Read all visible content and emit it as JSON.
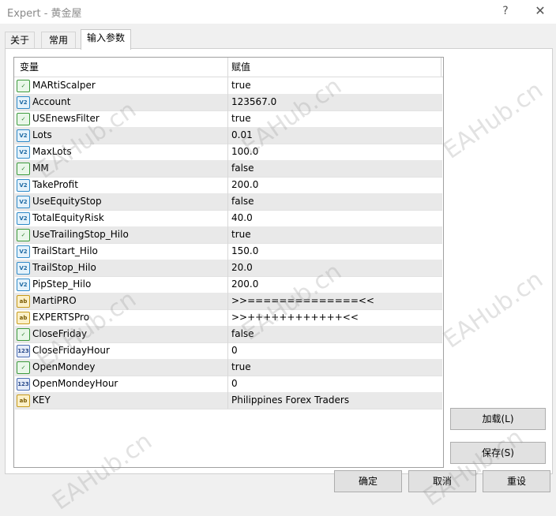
{
  "window": {
    "title": "Expert - 黄金屋",
    "help_label": "?",
    "close_label": "✕"
  },
  "tabs": [
    {
      "label": "关于",
      "active": false
    },
    {
      "label": "常用",
      "active": false
    },
    {
      "label": "输入参数",
      "active": true
    }
  ],
  "grid": {
    "headers": {
      "variable": "变量",
      "value": "赋值"
    },
    "rows": [
      {
        "type": "bool",
        "icon_label": "✓",
        "name": "MARtiScalper",
        "value": "true"
      },
      {
        "type": "double",
        "icon_label": "V2",
        "name": "Account",
        "value": "123567.0"
      },
      {
        "type": "bool",
        "icon_label": "✓",
        "name": "USEnewsFilter",
        "value": "true"
      },
      {
        "type": "double",
        "icon_label": "V2",
        "name": "Lots",
        "value": "0.01"
      },
      {
        "type": "double",
        "icon_label": "V2",
        "name": "MaxLots",
        "value": "100.0"
      },
      {
        "type": "bool",
        "icon_label": "✓",
        "name": "MM",
        "value": "false"
      },
      {
        "type": "double",
        "icon_label": "V2",
        "name": "TakeProfit",
        "value": "200.0"
      },
      {
        "type": "double",
        "icon_label": "V2",
        "name": "UseEquityStop",
        "value": "false"
      },
      {
        "type": "double",
        "icon_label": "V2",
        "name": "TotalEquityRisk",
        "value": "40.0"
      },
      {
        "type": "bool",
        "icon_label": "✓",
        "name": "UseTrailingStop_Hilo",
        "value": "true"
      },
      {
        "type": "double",
        "icon_label": "V2",
        "name": "TrailStart_Hilo",
        "value": "150.0"
      },
      {
        "type": "double",
        "icon_label": "V2",
        "name": "TrailStop_Hilo",
        "value": "20.0"
      },
      {
        "type": "double",
        "icon_label": "V2",
        "name": "PipStep_Hilo",
        "value": "200.0"
      },
      {
        "type": "string",
        "icon_label": "ab",
        "name": "MartiPRO",
        "value": ">>==============<<"
      },
      {
        "type": "string",
        "icon_label": "ab",
        "name": "EXPERTSPro",
        "value": ">>++++++++++++<<"
      },
      {
        "type": "bool",
        "icon_label": "✓",
        "name": "CloseFriday",
        "value": "false"
      },
      {
        "type": "int",
        "icon_label": "123",
        "name": "CloseFridayHour",
        "value": "0"
      },
      {
        "type": "bool",
        "icon_label": "✓",
        "name": "OpenMondey",
        "value": "true"
      },
      {
        "type": "int",
        "icon_label": "123",
        "name": "OpenMondeyHour",
        "value": "0"
      },
      {
        "type": "string",
        "icon_label": "ab",
        "name": "KEY",
        "value": "Philippines Forex Traders"
      }
    ]
  },
  "side_buttons": {
    "load": "加载(L)",
    "save": "保存(S)"
  },
  "footer_buttons": {
    "ok": "确定",
    "cancel": "取消",
    "reset": "重设"
  },
  "watermark": {
    "text": "EAHub.cn"
  }
}
